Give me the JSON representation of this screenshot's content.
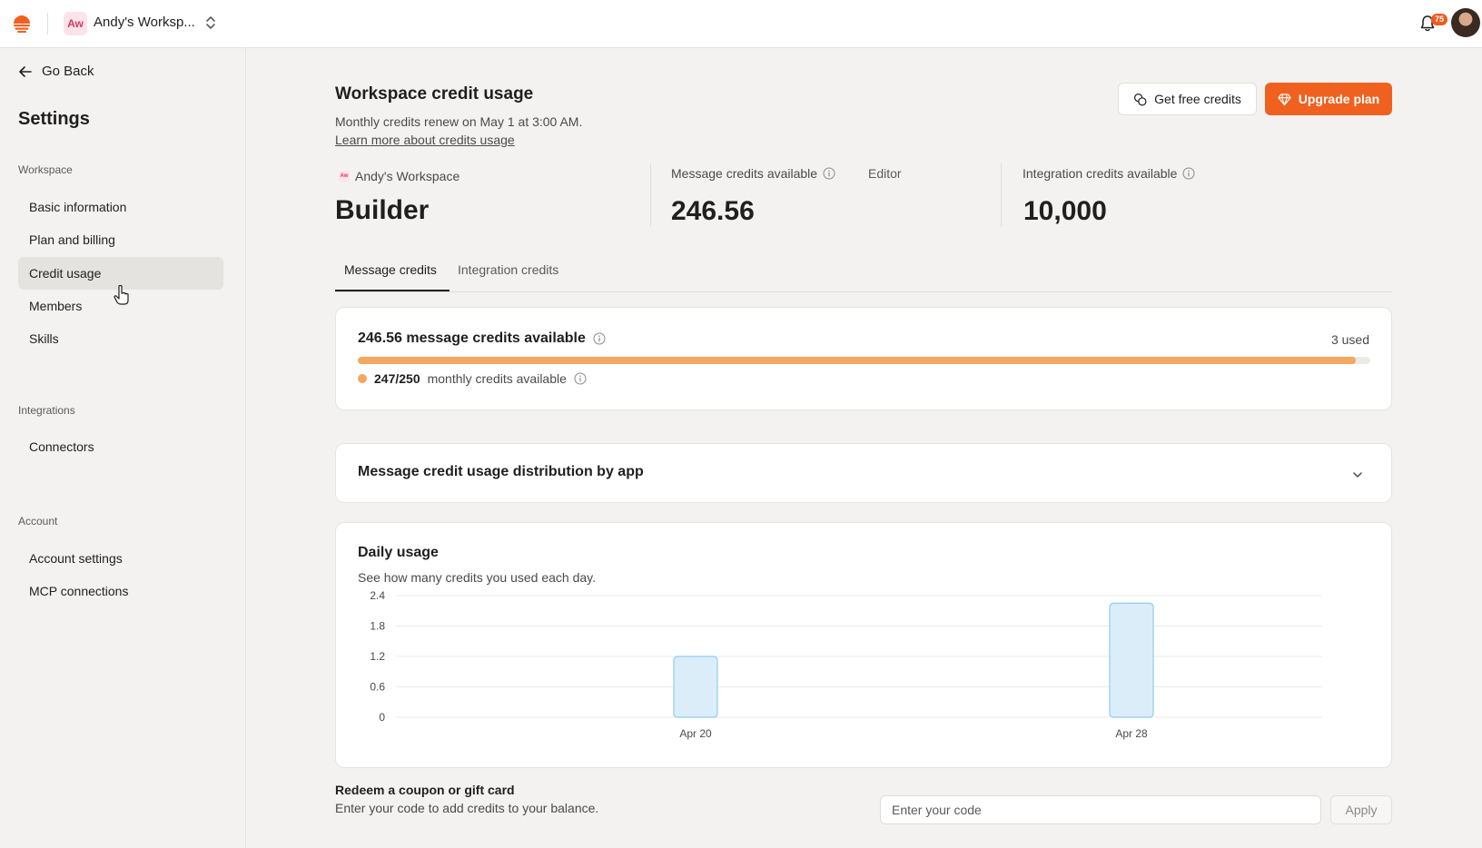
{
  "topbar": {
    "workspace_badge": "Aw",
    "workspace_name": "Andy's Worksp...",
    "notification_count": "75",
    "icons": [
      "logo-icon",
      "chevron-updown-icon",
      "bell-icon",
      "avatar"
    ]
  },
  "sidebar": {
    "go_back": "Go Back",
    "title": "Settings",
    "sections": {
      "workspace": "Workspace",
      "integrations": "Integrations",
      "account": "Account"
    },
    "items": {
      "basic_information": "Basic information",
      "plan_and_billing": "Plan and billing",
      "credit_usage": "Credit usage",
      "members": "Members",
      "skills": "Skills",
      "connectors": "Connectors",
      "account_settings": "Account settings",
      "mcp_connections": "MCP connections"
    },
    "active_item": "Credit usage"
  },
  "header": {
    "title": "Workspace credit usage",
    "renew_text": "Monthly credits renew on May 1 at 3:00 AM.",
    "learn_more": "Learn more about credits usage",
    "get_free_credits": "Get free credits",
    "upgrade_plan": "Upgrade plan"
  },
  "plan": {
    "workspace_badge": "Aw",
    "workspace_name": "Andy's Workspace",
    "role": "Editor",
    "plan_name": "Builder"
  },
  "stats": {
    "message_label": "Message credits available",
    "message_value": "246.56",
    "integration_label": "Integration credits available",
    "integration_value": "10,000"
  },
  "tabs": {
    "message": "Message credits",
    "integration": "Integration credits",
    "active": "Message credits"
  },
  "credits_card": {
    "title": "246.56 message credits available",
    "used": "3 used",
    "progress_fraction": 0.986,
    "monthly_amount": "247/250",
    "monthly_label": "monthly credits available"
  },
  "distribution": {
    "title": "Message credit usage distribution by app"
  },
  "daily_usage": {
    "title": "Daily usage",
    "subtitle": "See how many credits you used each day."
  },
  "chart_data": {
    "type": "bar",
    "title": "Daily usage",
    "xlabel": "",
    "ylabel": "",
    "ylim": [
      0,
      2.4
    ],
    "yticks": [
      "0",
      "0.6",
      "1.2",
      "1.8",
      "2.4"
    ],
    "categories": [
      "Apr 20",
      "Apr 28"
    ],
    "x_range_days": 17,
    "x_positions": [
      5,
      13
    ],
    "values": [
      1.2,
      2.25
    ],
    "grid": true,
    "colors": {
      "bar_fill": "#dcedfa",
      "bar_stroke": "#8fcdf2",
      "grid": "#ecebe8"
    }
  },
  "redeem": {
    "title": "Redeem a coupon or gift card",
    "subtitle": "Enter your code to add credits to your balance.",
    "placeholder": "Enter your code",
    "apply": "Apply"
  },
  "colors": {
    "accent": "#f0611f",
    "progress": "#f5a65f",
    "background": "#f3f2f0"
  }
}
